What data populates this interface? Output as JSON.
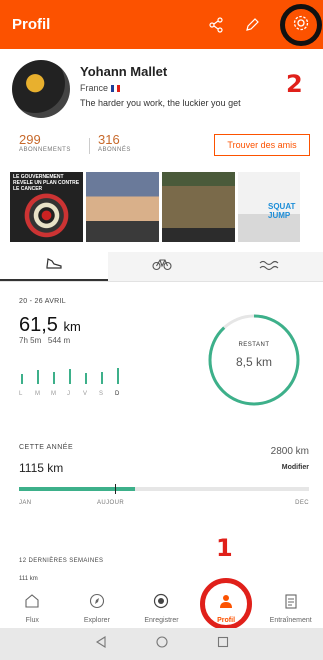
{
  "header": {
    "title": "Profil",
    "icons": [
      "share-icon",
      "pencil-icon",
      "gear-icon"
    ],
    "accent": "#fc5200"
  },
  "annotations": {
    "one": "1",
    "two": "2",
    "color": "#e0201a"
  },
  "profile": {
    "name": "Yohann Mallet",
    "country": "France",
    "motto": "The harder you work, the luckier you get"
  },
  "stats": {
    "followers_count": "299",
    "followers_label": "ABONNEMENTS",
    "following_count": "316",
    "following_label": "ABONNÉS",
    "find_friends": "Trouver des amis"
  },
  "photos": {
    "caption1": "LE GOUVERNEMENT REVELE UN PLAN CONTRE LE CANCER",
    "caption4": "SQUAT JUMP"
  },
  "sport_tabs": [
    {
      "icon": "shoe-icon",
      "active": true
    },
    {
      "icon": "bike-icon",
      "active": false
    },
    {
      "icon": "swim-icon",
      "active": false
    }
  ],
  "week": {
    "range": "20 - 26 AVRIL",
    "distance": "61,5",
    "distance_unit": "km",
    "time": "7h 5m",
    "elevation": "544 m",
    "days": [
      "L",
      "M",
      "M",
      "J",
      "V",
      "S",
      "D"
    ],
    "day_values": [
      0.5,
      0.7,
      0.6,
      0.75,
      0.55,
      0.6,
      0.8
    ],
    "remaining_label": "RESTANT",
    "remaining_value": "8,5 km",
    "goal_progress": 0.88
  },
  "year": {
    "label": "CETTE ANNÉE",
    "done": "1115 km",
    "goal": "2800 km",
    "edit": "Modifier",
    "progress": 0.4,
    "today_marker": 0.33,
    "start": "JAN",
    "today": "AUJOUR",
    "end": "DEC"
  },
  "weeks12": {
    "label": "12 DERNIÈRES SEMAINES",
    "axis": "111 km"
  },
  "bottom_nav": [
    {
      "label": "Flux",
      "icon": "home-icon"
    },
    {
      "label": "Explorer",
      "icon": "compass-icon"
    },
    {
      "label": "Enregistrer",
      "icon": "record-icon"
    },
    {
      "label": "Profil",
      "icon": "person-icon",
      "active": true
    },
    {
      "label": "Entraînement",
      "icon": "calendar-icon"
    }
  ]
}
